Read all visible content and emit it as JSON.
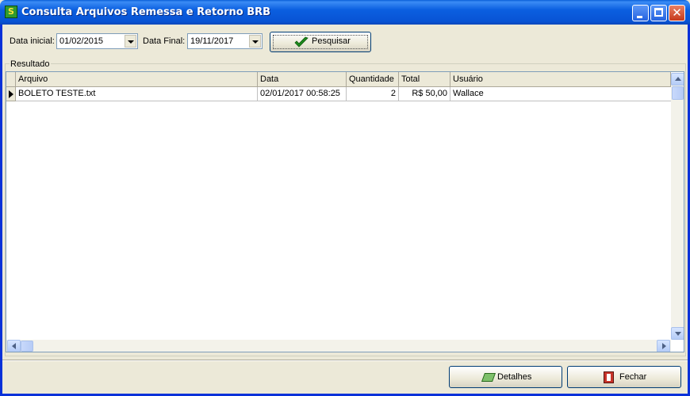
{
  "window": {
    "icon_text": "S",
    "title": "Consulta Arquivos Remessa e Retorno BRB"
  },
  "filters": {
    "start_label": "Data inicial:",
    "start_value": "01/02/2015",
    "end_label": "Data Final:",
    "end_value": "19/11/2017",
    "search_button": "Pesquisar"
  },
  "result": {
    "group_label": "Resultado",
    "columns": [
      "Arquivo",
      "Data",
      "Quantidade",
      "Total",
      "Usuário"
    ],
    "rows": [
      [
        "BOLETO TESTE.txt",
        "02/01/2017 00:58:25",
        "2",
        "R$ 50,00",
        "Wallace"
      ]
    ]
  },
  "footer": {
    "details_button": "Detalhes",
    "close_button": "Fechar"
  },
  "colors": {
    "titlebar": "#0a5fe0",
    "window_bg": "#ece9d8",
    "close_button": "#c6391b"
  }
}
